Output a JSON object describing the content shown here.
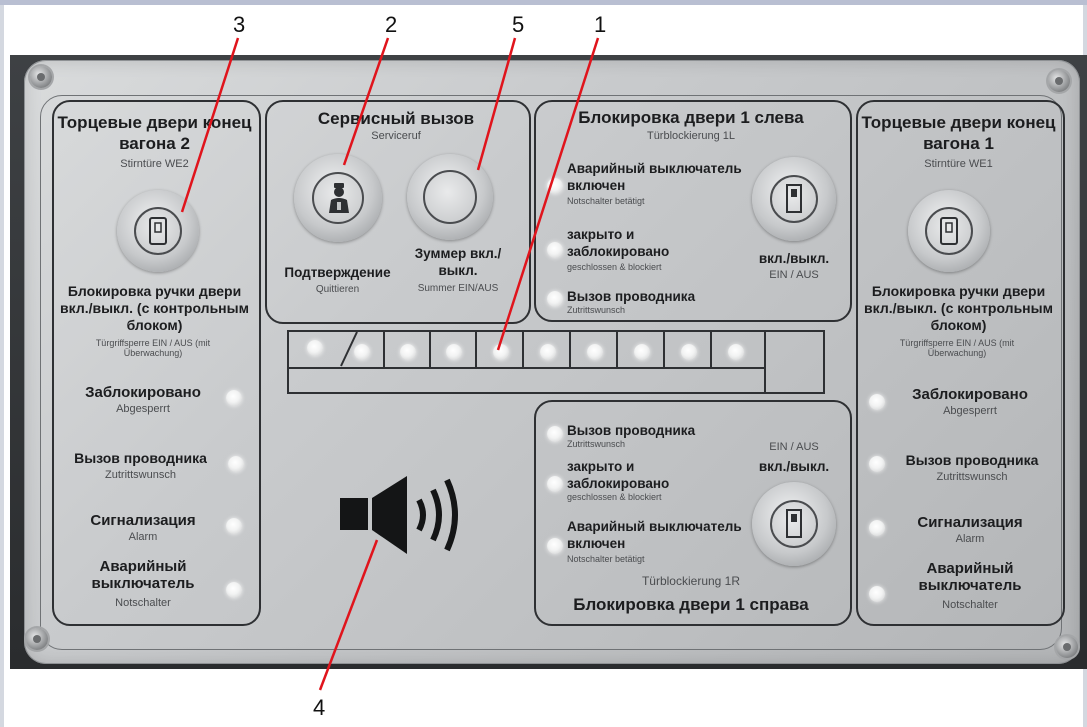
{
  "callouts": [
    "3",
    "2",
    "5",
    "1",
    "4"
  ],
  "left_door": {
    "title_ru": "Торцевые двери конец вагона 2",
    "title_de": "Stirntüre WE2",
    "button_label_ru": "Блокировка ручки двери вкл./выкл. (с контрольным блоком)",
    "button_label_de": "Türgriffsperre EIN / AUS (mit Überwachung)",
    "indicators": [
      {
        "ru": "Заблокировано",
        "de": "Abgesperrt"
      },
      {
        "ru": "Вызов проводника",
        "de": "Zutrittswunsch"
      },
      {
        "ru": "Сигнализация",
        "de": "Alarm"
      },
      {
        "ru": "Аварийный выключатель",
        "de": "Notschalter"
      }
    ]
  },
  "service": {
    "title_ru": "Сервисный вызов",
    "title_de": "Serviceruf",
    "confirm_ru": "Подтверждение",
    "confirm_de": "Quittieren",
    "buzzer_ru": "Зуммер вкл./выкл.",
    "buzzer_de": "Summer EIN/AUS"
  },
  "lock_left": {
    "title_ru": "Блокировка двери 1 слева",
    "title_de": "Türblockierung 1L",
    "items": [
      {
        "ru": "Аварийный выключатель включен",
        "de": "Notschalter betätigt"
      },
      {
        "ru": "закрыто и заблокировано",
        "de": "geschlossen & blockiert"
      },
      {
        "ru": "Вызов проводника",
        "de": "Zutrittswunsch"
      }
    ],
    "toggle_ru": "вкл./выкл.",
    "toggle_de": "EIN / AUS"
  },
  "lock_right": {
    "title_ru": "Блокировка двери 1 справа",
    "title_de": "Türblockierung 1R",
    "items": [
      {
        "ru": "Вызов проводника",
        "de": "Zutrittswunsch"
      },
      {
        "ru": "закрыто и заблокировано",
        "de": "geschlossen & blockiert"
      },
      {
        "ru": "Аварийный выключатель включен",
        "de": "Notschalter betätigt"
      }
    ],
    "toggle_ru": "вкл./выкл.",
    "toggle_de": "EIN / AUS"
  },
  "right_door": {
    "title_ru": "Торцевые двери конец вагона 1",
    "title_de": "Stirntüre WE1",
    "button_label_ru": "Блокировка ручки двери вкл./выкл. (с контрольным блоком)",
    "button_label_de": "Türgriffsperre EIN / AUS (mit Überwachung)",
    "indicators": [
      {
        "ru": "Заблокировано",
        "de": "Abgesperrt"
      },
      {
        "ru": "Вызов проводника",
        "de": "Zutrittswunsch"
      },
      {
        "ru": "Сигнализация",
        "de": "Alarm"
      },
      {
        "ru": "Аварийный выключатель",
        "de": "Notschalter"
      }
    ]
  },
  "colors": {
    "callout_line": "#e0141c",
    "panel": "#c9cbcd",
    "ink": "#2e3033"
  }
}
